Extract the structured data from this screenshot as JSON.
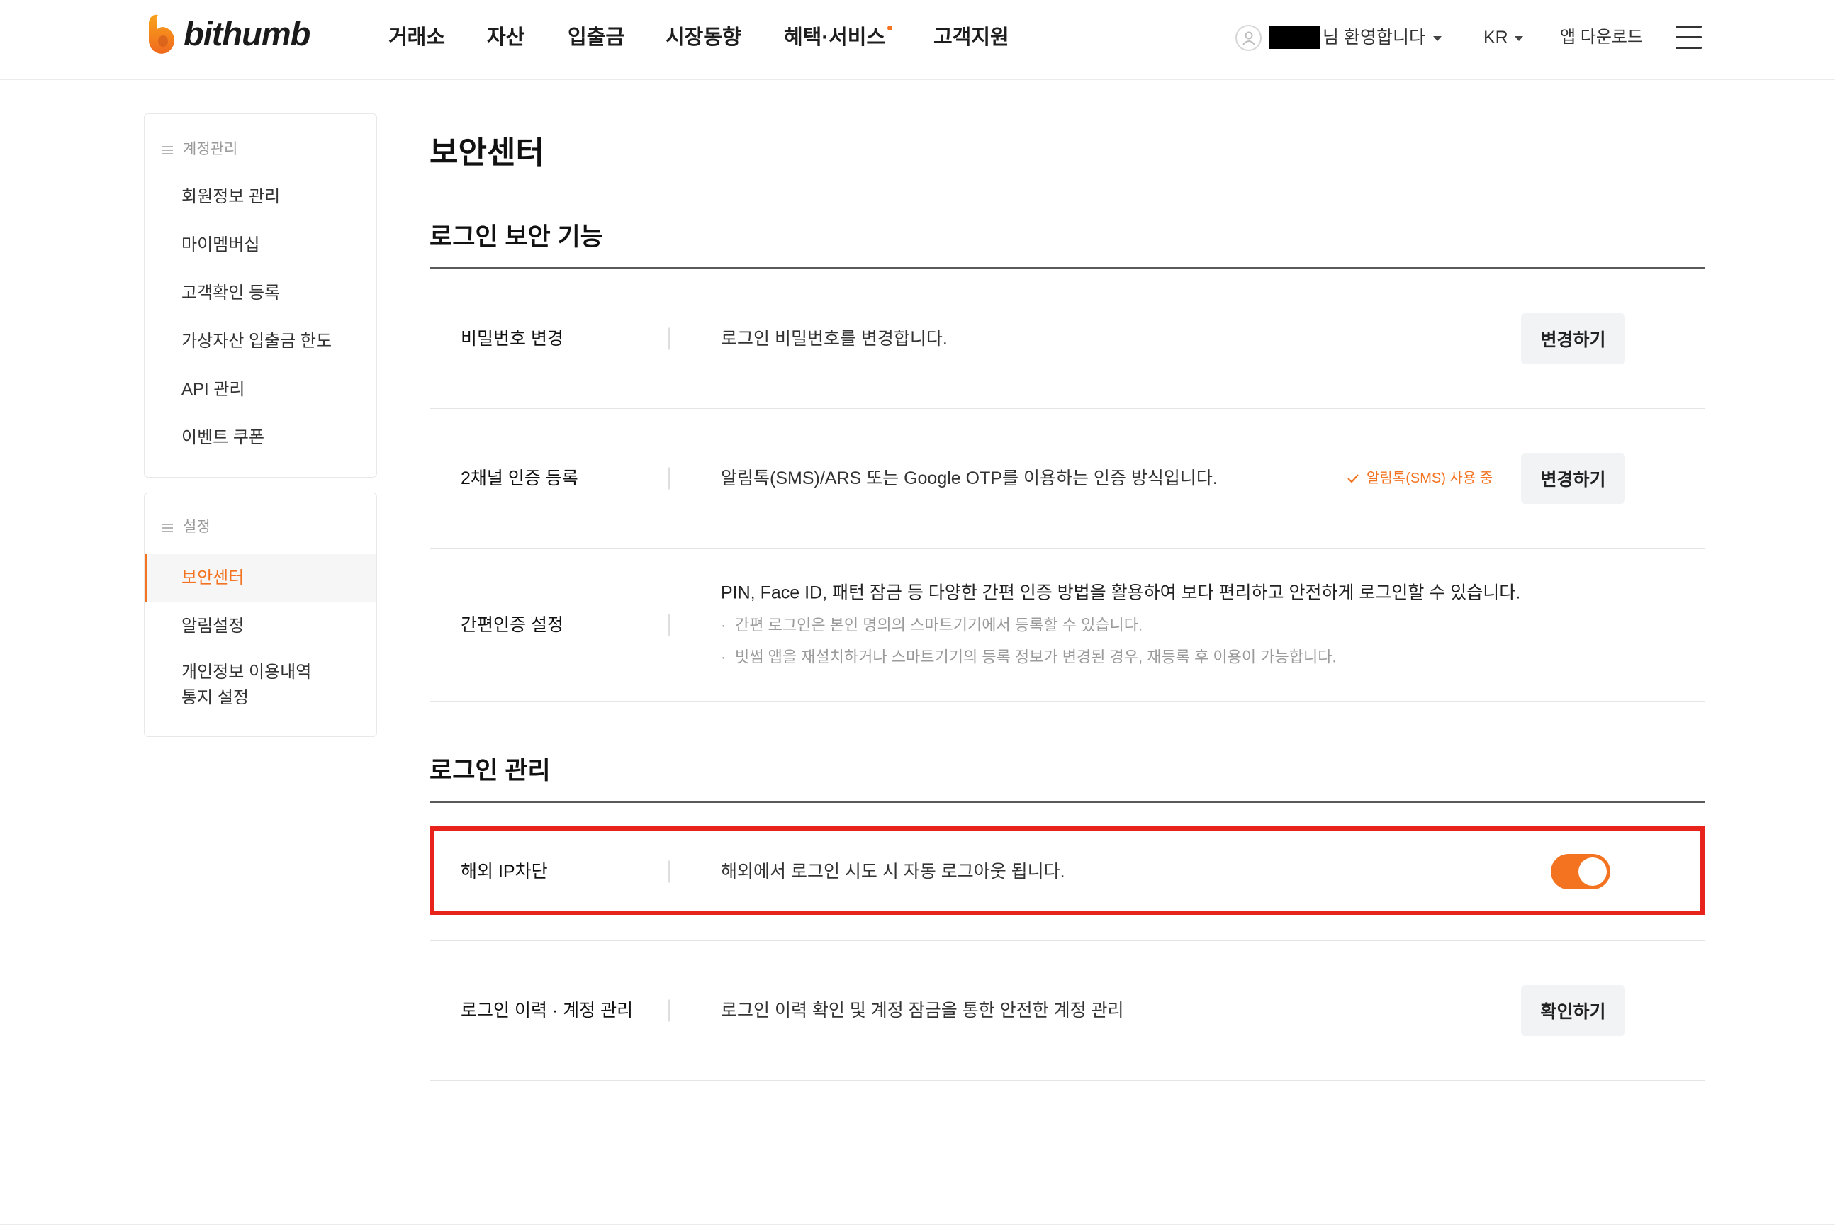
{
  "header": {
    "logo_text": "bithumb",
    "nav": [
      {
        "label": "거래소"
      },
      {
        "label": "자산"
      },
      {
        "label": "입출금"
      },
      {
        "label": "시장동향"
      },
      {
        "label": "혜택·서비스",
        "new_indicator": true
      },
      {
        "label": "고객지원"
      }
    ],
    "user": {
      "greeting": "님 환영합니다"
    },
    "language": "KR",
    "app_download": "앱 다운로드"
  },
  "sidebar": {
    "sections": [
      {
        "heading": "계정관리",
        "items": [
          {
            "label": "회원정보 관리"
          },
          {
            "label": "마이멤버십"
          },
          {
            "label": "고객확인 등록"
          },
          {
            "label": "가상자산 입출금 한도"
          },
          {
            "label": "API 관리"
          },
          {
            "label": "이벤트 쿠폰"
          }
        ]
      },
      {
        "heading": "설정",
        "items": [
          {
            "label": "보안센터",
            "active": true
          },
          {
            "label": "알림설정"
          },
          {
            "label": "개인정보 이용내역\n통지 설정"
          }
        ]
      }
    ]
  },
  "main": {
    "title": "보안센터",
    "sections": [
      {
        "title": "로그인 보안 기능",
        "rows": [
          {
            "label": "비밀번호 변경",
            "desc": "로그인 비밀번호를 변경합니다.",
            "button": "변경하기"
          },
          {
            "label": "2채널 인증 등록",
            "desc": "알림톡(SMS)/ARS 또는 Google OTP를 이용하는 인증 방식입니다.",
            "status": "알림톡(SMS) 사용 중",
            "button": "변경하기"
          },
          {
            "label": "간편인증 설정",
            "desc": "PIN, Face ID, 패턴 잠금 등 다양한 간편 인증 방법을 활용하여 보다 편리하고 안전하게 로그인할 수 있습니다.",
            "notes": [
              "간편 로그인은 본인 명의의 스마트기기에서 등록할 수 있습니다.",
              "빗썸 앱을 재설치하거나 스마트기기의 등록 정보가 변경된 경우, 재등록 후 이용이 가능합니다."
            ]
          }
        ]
      },
      {
        "title": "로그인 관리",
        "rows": [
          {
            "label": "해외 IP차단",
            "desc": "해외에서 로그인 시도 시 자동 로그아웃 됩니다.",
            "toggle_on": true,
            "highlighted": true
          },
          {
            "label": "로그인 이력 · 계정 관리",
            "desc": "로그인 이력 확인 및 계정 잠금을 통한 안전한 계정 관리",
            "button": "확인하기"
          }
        ]
      }
    ]
  },
  "colors": {
    "accent": "#f37321",
    "toggle": "#f47320",
    "highlight": "#e8231c"
  }
}
